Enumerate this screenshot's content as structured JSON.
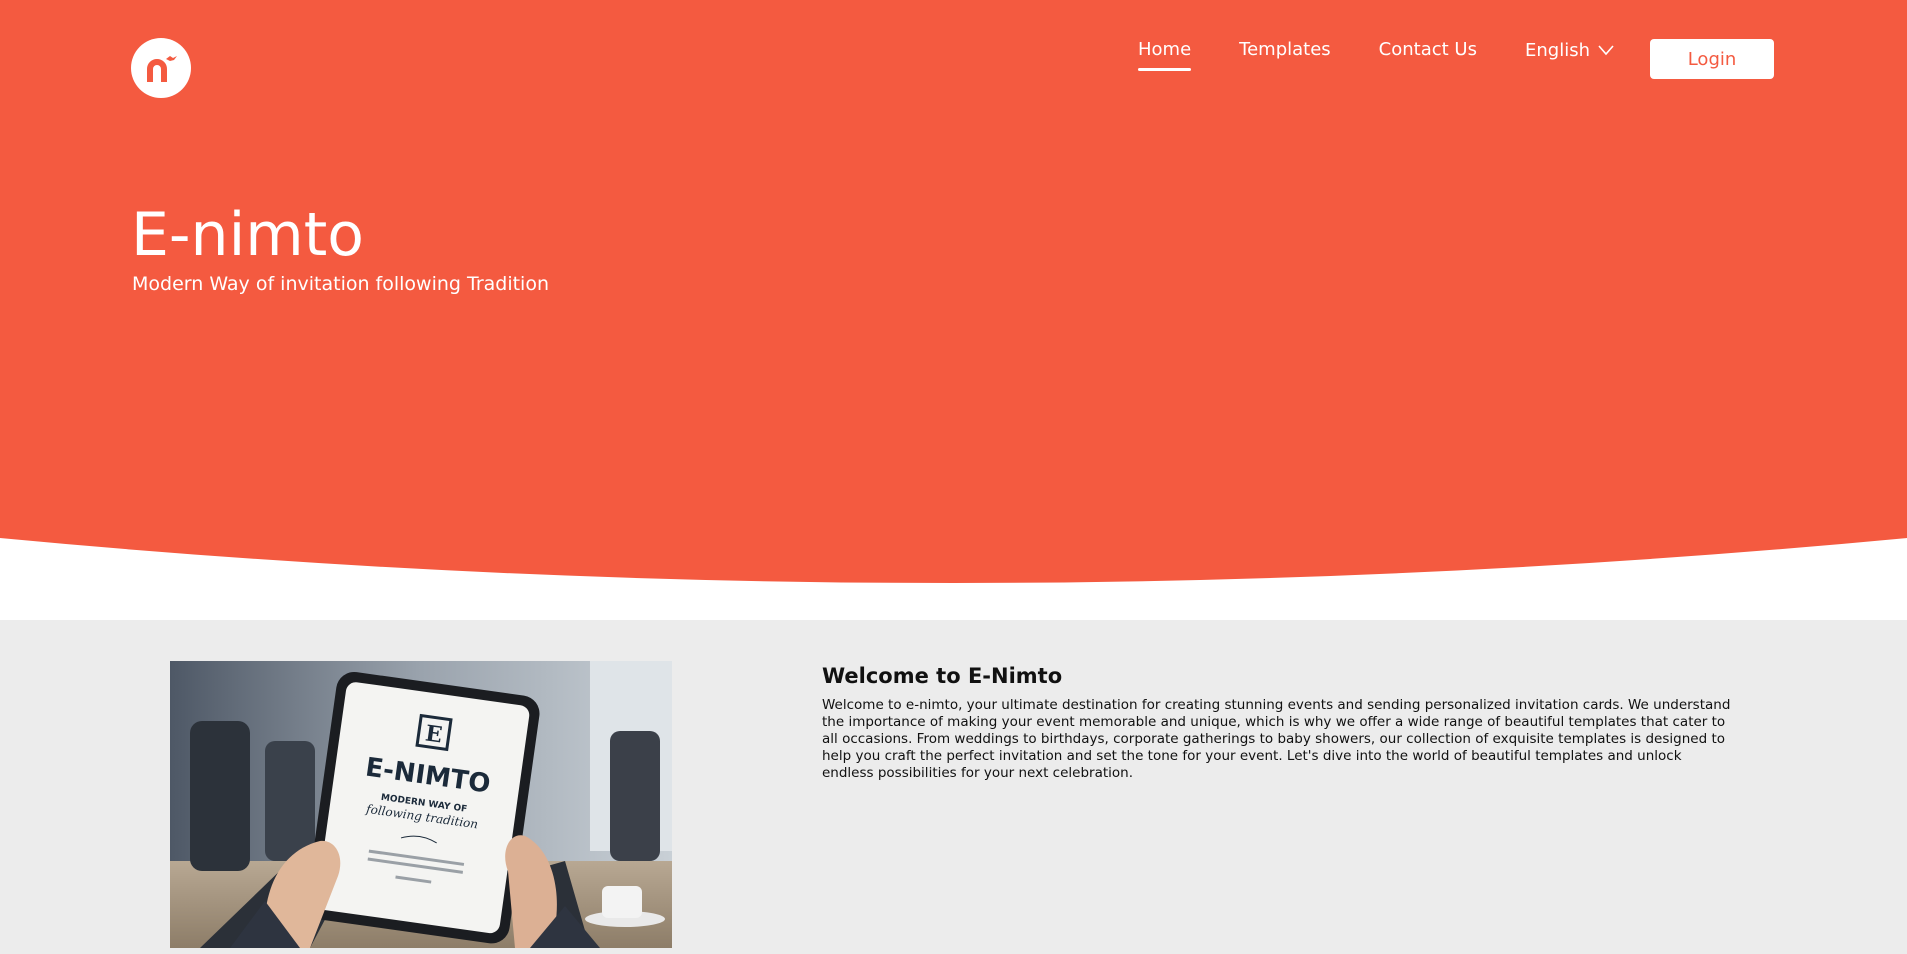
{
  "brand": {
    "logo_icon": "enimto-logo-icon",
    "primary_color": "#f45a40"
  },
  "nav": {
    "items": [
      {
        "label": "Home",
        "active": true
      },
      {
        "label": "Templates",
        "active": false
      },
      {
        "label": "Contact Us",
        "active": false
      }
    ],
    "language": {
      "label": "English",
      "icon": "chevron-down-icon"
    },
    "login_label": "Login"
  },
  "hero": {
    "title": "E-nimto",
    "subtitle": "Modern Way of invitation following Tradition"
  },
  "welcome": {
    "title": "Welcome to E-Nimto",
    "text": "Welcome to e-nimto, your ultimate destination for creating stunning events and sending personalized invitation cards. We understand the importance of making your event memorable and unique, which is why we offer a wide range of beautiful templates that cater to all occasions. From weddings to birthdays, corporate gatherings to baby showers, our collection of exquisite templates is designed to help you craft the perfect invitation and set the tone for your event. Let's dive into the world of beautiful templates and unlock endless possibilities for your next celebration.",
    "image": {
      "card_title": "E-NIMTO",
      "card_sub_1": "MODERN WAY OF",
      "card_sub_2": "following tradition"
    }
  }
}
